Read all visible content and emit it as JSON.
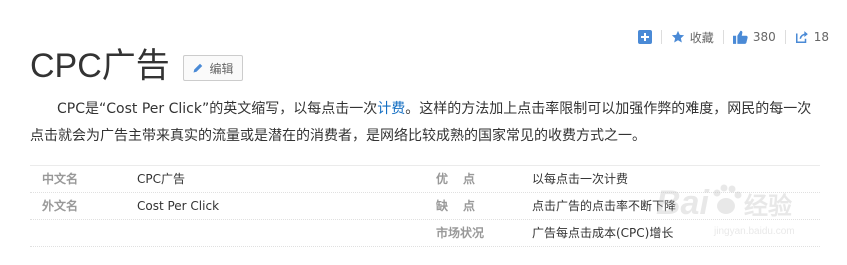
{
  "toolbar": {
    "add_icon": "plus-square-icon",
    "favorite_icon": "star-icon",
    "favorite_label": "收藏",
    "like_icon": "thumbs-up-icon",
    "like_count": "380",
    "share_icon": "share-icon",
    "share_count": "18",
    "accent_color": "#4a8ad6"
  },
  "title": "CPC广告",
  "edit_button": {
    "label": "编辑",
    "icon": "pencil-icon"
  },
  "summary": {
    "before_link": "CPC是“Cost Per Click”的英文缩写，以每点击一次",
    "link_text": "计费",
    "after_link": "。这样的方法加上点击率限制可以加强作弊的难度，网民的每一次点击就会为广告主带来真实的流量或是潜在的消费者，是网络比较成熟的国家常见的收费方式之一。",
    "link_color": "#136ec2"
  },
  "info_table": [
    {
      "left_name": "中文名",
      "left_value": "CPC广告",
      "right_name": "优点",
      "right_value": "以每点击一次计费"
    },
    {
      "left_name": "外文名",
      "left_value": "Cost Per Click",
      "right_name": "缺点",
      "right_value": "点击广告的点击率不断下降"
    },
    {
      "left_name": "",
      "left_value": "",
      "right_name": "市场状况",
      "right_value": "广告每点击成本(CPC)增长"
    }
  ],
  "watermark": {
    "brand": "Bai",
    "brand_suffix": "经验",
    "url": "jingyan.baidu.com",
    "icon": "baidu-paw-icon"
  }
}
